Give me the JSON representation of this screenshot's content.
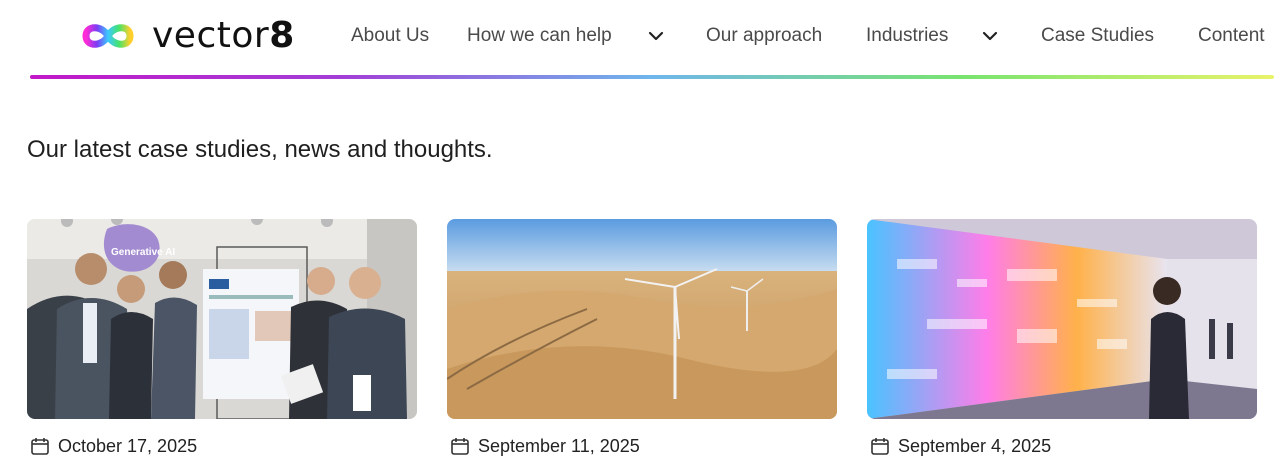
{
  "brand": {
    "name_light": "vector",
    "name_bold": "8",
    "logo_icon": "infinity-rainbow-logo"
  },
  "nav": {
    "items": [
      {
        "label": "About Us"
      },
      {
        "label": "How we can help"
      },
      {
        "label": "Our approach"
      },
      {
        "label": "Industries"
      },
      {
        "label": "Case Studies"
      },
      {
        "label": "Content"
      }
    ],
    "dropdown_icon": "chevron-down-icon"
  },
  "colors": {
    "gradient": [
      "#c218c8",
      "#a23ed6",
      "#6fb6ec",
      "#78e46f",
      "#e9f36a"
    ]
  },
  "headline": "Our latest case studies, news and thoughts.",
  "cards": [
    {
      "badge": "Generative AI",
      "date": "October 17, 2025",
      "image": "team-at-poster-photo"
    },
    {
      "date": "September 11, 2025",
      "image": "wind-turbines-desert-photo"
    },
    {
      "date": "September 4, 2025",
      "image": "woman-data-wall-photo"
    }
  ],
  "date_icon": "calendar-icon"
}
